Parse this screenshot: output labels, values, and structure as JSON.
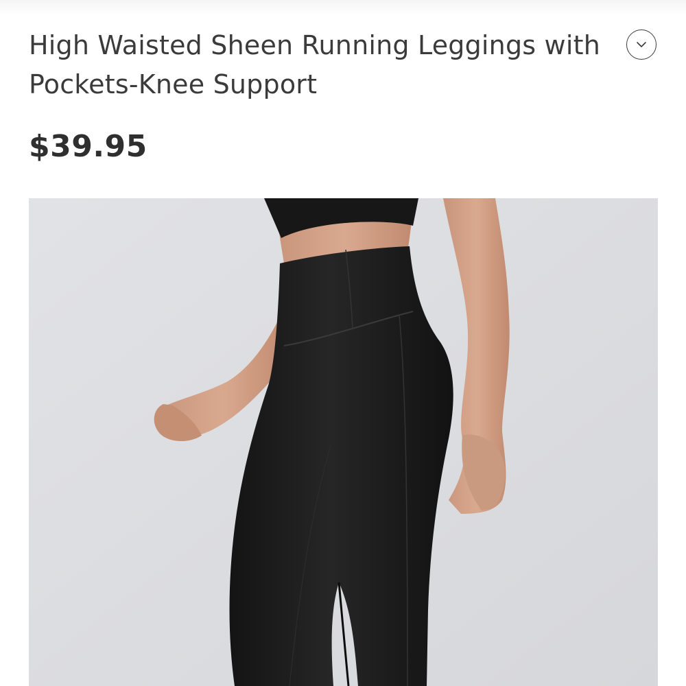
{
  "product": {
    "title": "High Waisted Sheen Running Leggings with Pockets-Knee Support",
    "price": "$39.95",
    "image_subject": "model wearing black high waisted leggings",
    "expand_icon": "chevron-down-icon"
  },
  "colors": {
    "title_text": "#3b3b3b",
    "price_text": "#2f2f2f",
    "image_background": "#dcdde0",
    "legging_black": "#1b1b1b",
    "skin": "#cf9f86"
  }
}
